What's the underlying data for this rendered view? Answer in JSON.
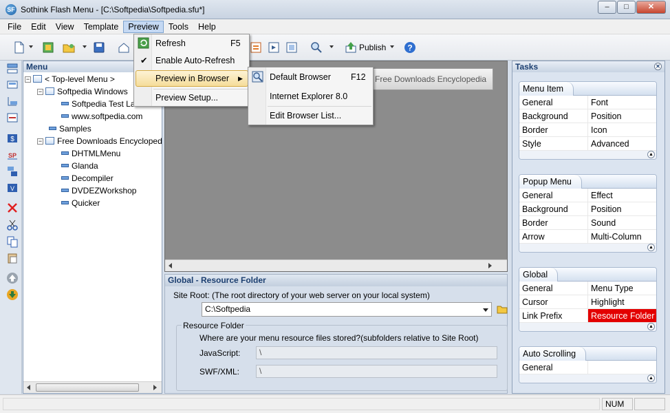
{
  "window": {
    "title": "Sothink Flash Menu - [C:\\Softpedia\\Softpedia.sfu*]",
    "app_icon": "SF",
    "min": "–",
    "max": "□",
    "close": "✕"
  },
  "menubar": [
    "File",
    "Edit",
    "View",
    "Template",
    "Preview",
    "Tools",
    "Help"
  ],
  "toolbar": {
    "publish_label": "Publish"
  },
  "preview_menu": {
    "items": [
      {
        "label": "Refresh",
        "shortcut": "F5"
      },
      {
        "label": "Enable Auto-Refresh",
        "checked": "✔"
      },
      {
        "label": "Preview in Browser",
        "arrow": "▶"
      },
      {
        "label": "Preview Setup..."
      }
    ]
  },
  "browser_submenu": {
    "items": [
      {
        "label": "Default Browser",
        "shortcut": "F12"
      },
      {
        "label": "Internet Explorer 8.0"
      },
      {
        "label": "Edit Browser List..."
      }
    ]
  },
  "menu_panel": {
    "title": "Menu",
    "tree": [
      {
        "label": "< Top-level Menu >"
      },
      {
        "label": "Softpedia Windows"
      },
      {
        "label": "Softpedia Test La"
      },
      {
        "label": "www.softpedia.com"
      },
      {
        "label": "Samples"
      },
      {
        "label": "Free Downloads Encycloped"
      },
      {
        "label": "DHTMLMenu"
      },
      {
        "label": "Glanda"
      },
      {
        "label": "Decompiler"
      },
      {
        "label": "DVDEZWorkshop"
      },
      {
        "label": "Quicker"
      }
    ]
  },
  "preview": {
    "bar_text": "Free Downloads Encyclopedia"
  },
  "global_panel": {
    "title": "Global - Resource Folder",
    "site_root_label": "Site Root: (The root directory of your web server on your local system)",
    "site_root_value": "C:\\Softpedia",
    "resource_folder_label": "Resource Folder",
    "resource_question": "Where are your menu resource files stored?(subfolders relative to Site Root)",
    "javascript_label": "JavaScript:",
    "javascript_value": "\\",
    "swf_label": "SWF/XML:",
    "swf_value": "\\"
  },
  "tasks": {
    "title": "Tasks",
    "groups": [
      {
        "title": "Menu Item",
        "items": [
          "General",
          "Font",
          "Background",
          "Position",
          "Border",
          "Icon",
          "Style",
          "Advanced"
        ]
      },
      {
        "title": "Popup Menu",
        "items": [
          "General",
          "Effect",
          "Background",
          "Position",
          "Border",
          "Sound",
          "Arrow",
          "Multi-Column"
        ]
      },
      {
        "title": "Global",
        "items": [
          "General",
          "Menu Type",
          "Cursor",
          "Highlight",
          "Link Prefix",
          "Resource Folder"
        ]
      },
      {
        "title": "Auto Scrolling",
        "items": [
          "General",
          ""
        ]
      }
    ]
  },
  "statusbar": {
    "num": "NUM"
  },
  "colors": {
    "selected_task": "#e30000",
    "accent": "#1c3f70"
  }
}
